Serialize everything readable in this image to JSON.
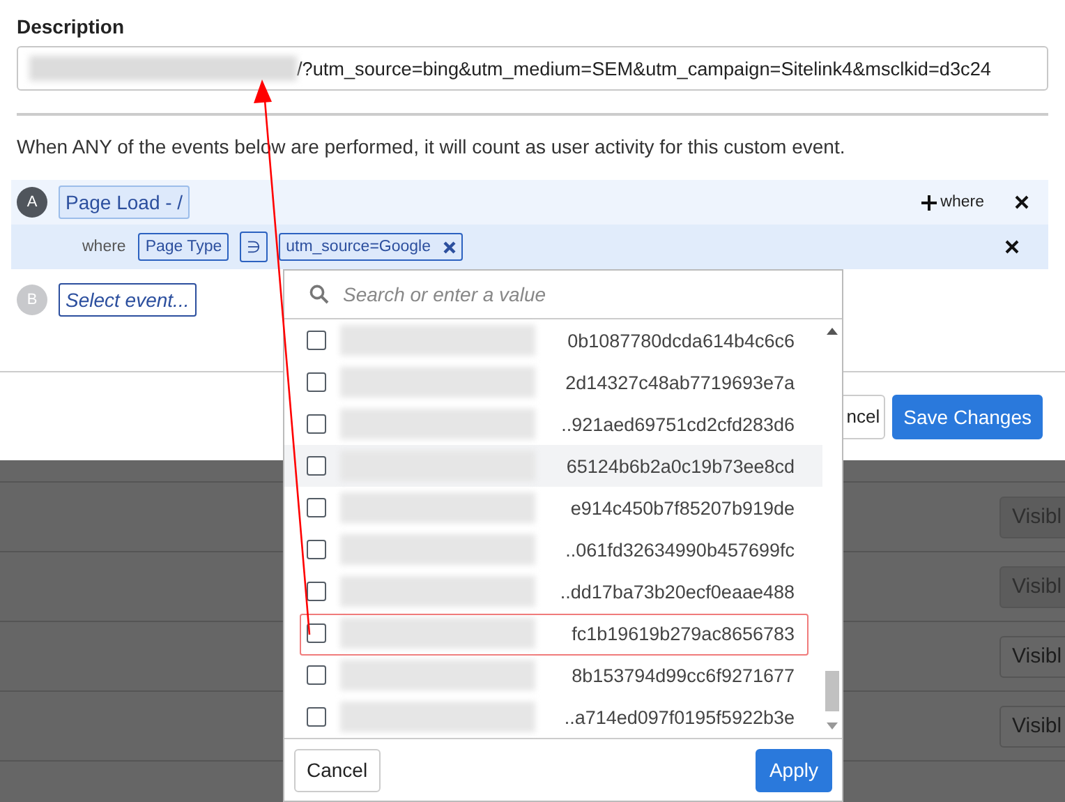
{
  "description": {
    "label": "Description",
    "value": "/?utm_source=bing&utm_medium=SEM&utm_campaign=Sitelink4&msclkid=d3c24"
  },
  "intro": "When ANY of the events below are performed, it will count as user activity for this custom event.",
  "events": [
    {
      "letter": "A",
      "kind": "chosen",
      "name": "Page Load - /",
      "add_filter": "where",
      "filters": [
        {
          "prefix": "where",
          "property": "Page Type",
          "operator": "∋",
          "value": "utm_source=Google"
        }
      ]
    },
    {
      "letter": "B",
      "kind": "empty",
      "name": "Select event..."
    }
  ],
  "footer_buttons": [
    {
      "label": "ncel",
      "kind": "secondary"
    },
    {
      "label": "Save Changes",
      "kind": "primary"
    }
  ],
  "background_rows": [
    {
      "button": "Visibl",
      "disabled": true
    },
    {
      "button": "Visibl",
      "disabled": true
    },
    {
      "button": "Visibl",
      "disabled": false
    },
    {
      "button": "Visibl",
      "disabled": false
    }
  ],
  "dropdown": {
    "placeholder": "Search or enter a value",
    "options": [
      {
        "value": "0b1087780dcda614b4c6c6",
        "checked": false,
        "hovered": false,
        "highlighted": false
      },
      {
        "value": "2d14327c48ab7719693e7a",
        "checked": false,
        "hovered": false,
        "highlighted": false
      },
      {
        "value": "..921aed69751cd2cfd283d6",
        "checked": false,
        "hovered": false,
        "highlighted": false
      },
      {
        "value": "65124b6b2a0c19b73ee8cd",
        "checked": false,
        "hovered": true,
        "highlighted": false
      },
      {
        "value": "e914c450b7f85207b919de",
        "checked": false,
        "hovered": false,
        "highlighted": false
      },
      {
        "value": "..061fd32634990b457699fc",
        "checked": false,
        "hovered": false,
        "highlighted": false
      },
      {
        "value": "..dd17ba73b20ecf0eaae488",
        "checked": false,
        "hovered": false,
        "highlighted": false
      },
      {
        "value": "fc1b19619b279ac8656783",
        "checked": false,
        "hovered": false,
        "highlighted": true
      },
      {
        "value": "8b153794d99cc6f9271677",
        "checked": false,
        "hovered": false,
        "highlighted": false
      },
      {
        "value": "..a714ed097f0195f5922b3e",
        "checked": false,
        "hovered": false,
        "highlighted": false
      }
    ],
    "cancel": "Cancel",
    "apply": "Apply"
  }
}
